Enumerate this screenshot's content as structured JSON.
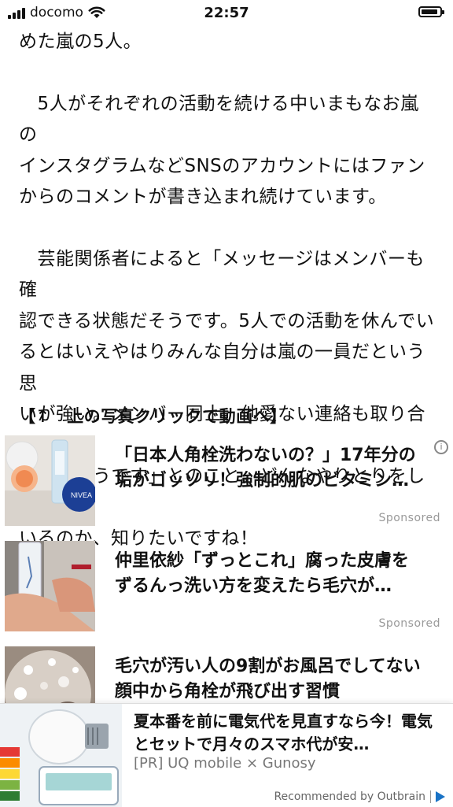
{
  "status_bar": {
    "carrier": "docomo",
    "time": "22:57"
  },
  "article": {
    "lead_line": "めた嵐の5人。",
    "para2_lines": [
      "　5人がそれぞれの活動を続ける中いまもなお嵐の",
      "インスタグラムなどSNSのアカウントにはファン",
      "からのコメントが書き込まれ続けています。"
    ],
    "para3_lines": [
      "　芸能関係者によると「メッセージはメンバーも確",
      "認できる状態だそうです。5人での活動を休んでい",
      "るとはいえやはりみんな自分は嵐の一員だという思",
      "いが強い。メンバー同士、他愛ない連絡も取り合っ",
      "ているそうです」とのこと。どんなやりとりをして",
      "いるのか、知りたいですね！"
    ],
    "caption": "【↑　上の写真クリックで動画へ】"
  },
  "recommendations": [
    {
      "title": "「日本人角栓洗わないの？」17年分の垢がゴッソリ！強制的肌のビタミン…",
      "label": "Sponsored"
    },
    {
      "title": "仲里依紗「ずっとこれ」腐った皮膚をずるんっ洗い方を変えたら毛穴が…",
      "label": "Sponsored"
    },
    {
      "title": "毛穴が汚い人の9割がお風呂でしてない顔中から角栓が飛び出す習慣",
      "label": ""
    }
  ],
  "bottom_ad": {
    "title": "夏本番を前に電気代を見直すなら今！電気とセットで月々のスマホ代が安…",
    "source": "[PR] UQ mobile × Gunosy",
    "credit": "Recommended by Outbrain"
  },
  "icons": {
    "adchoices": "adchoices-icon",
    "outbrain": "outbrain-icon",
    "wifi": "wifi-icon",
    "battery": "battery-icon",
    "signal": "signal-icon"
  },
  "colors": {
    "sponsored": "#999999",
    "outbrain_blue": "#1a73c6"
  }
}
